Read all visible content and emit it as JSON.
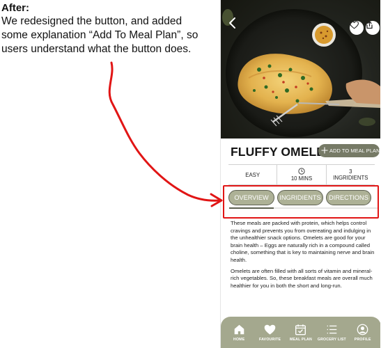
{
  "annotation": {
    "heading": "After:",
    "body": "We redesigned the button, and added some explanation “Add To Meal Plan”, so users understand what the button does."
  },
  "recipe": {
    "title": "FLUFFY OMELET",
    "add_button_label": "ADD TO MEAL PLAN",
    "stats": [
      {
        "label": "EASY",
        "icon": ""
      },
      {
        "label": "10 MINS",
        "icon": "clock-icon"
      },
      {
        "top": "3",
        "label": "INGRIDIENTS"
      }
    ],
    "tabs": [
      "OVERVIEW",
      "INGRIDIENTS",
      "DIRECTIONS"
    ],
    "active_tab": "OVERVIEW",
    "paragraphs": [
      "These meals are packed with protein, which helps control cravings and prevents you from overeating and indulging in the unhealthier snack options. Omelets are good for your brain health – Eggs are naturally rich in a compound called choline, something that is key to maintaining nerve and brain health.",
      "Omelets are often filled with all sorts of vitamin and mineral-rich vegetables. So, these breakfast meals are overall much healthier for you in both the short and long-run."
    ]
  },
  "nav": {
    "items": [
      {
        "label": "HOME",
        "icon": "home-icon"
      },
      {
        "label": "FAVOURITE",
        "icon": "heart-icon"
      },
      {
        "label": "MEAL PLAN",
        "icon": "calendar-icon"
      },
      {
        "label": "GROCERY LIST",
        "icon": "list-icon"
      },
      {
        "label": "PROFILE",
        "icon": "profile-icon"
      }
    ]
  },
  "colors": {
    "accent": "#767a66",
    "tab_fill": "#adb196",
    "nav_fill": "#a4a88e",
    "highlight": "#e11515"
  }
}
